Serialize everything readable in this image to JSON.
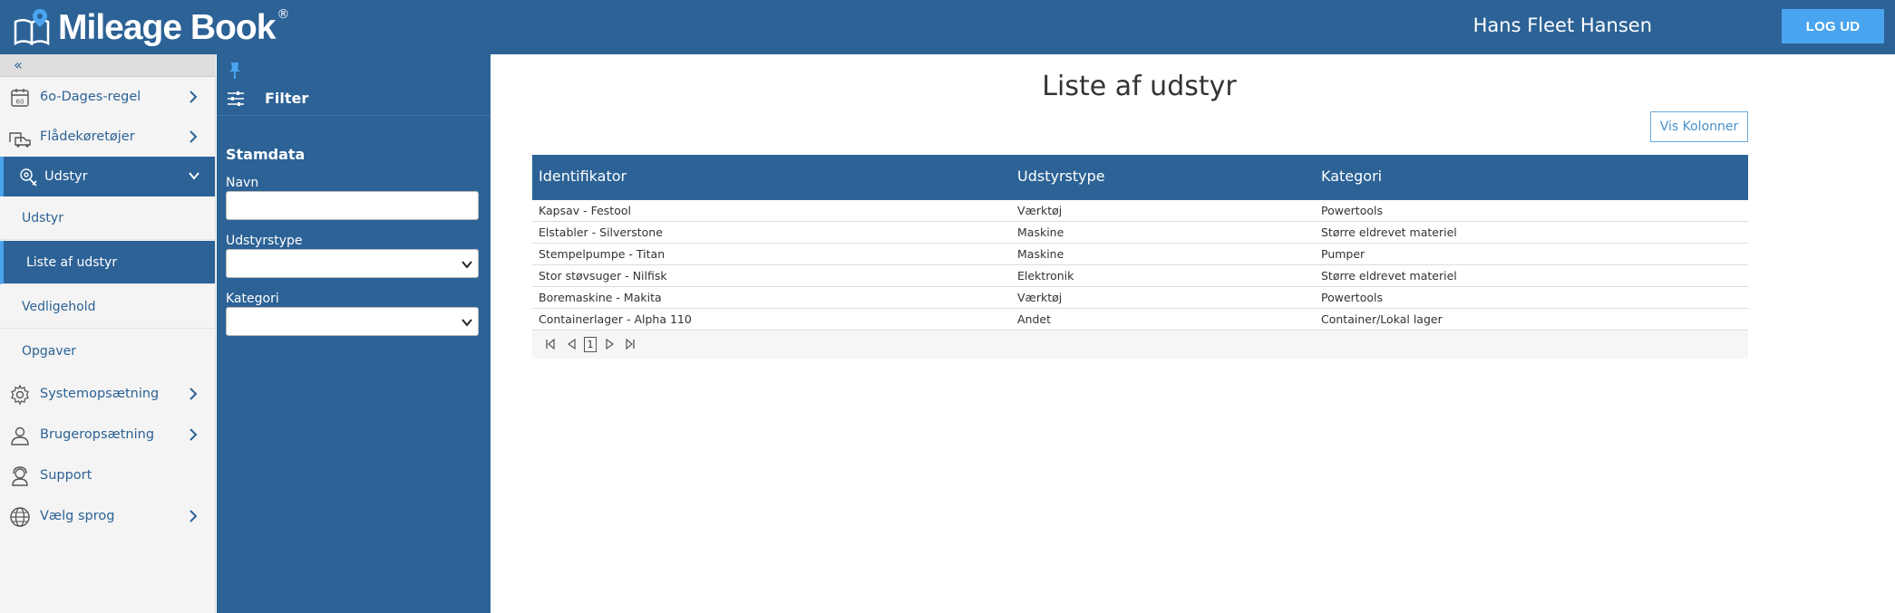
{
  "header": {
    "app_name": "Mileage Book",
    "reg_mark": "®",
    "user_name": "Hans Fleet Hansen",
    "logout_label": "LOG UD",
    "bg_color": "#2c6296",
    "accent_color": "#4aa4ef"
  },
  "nav": {
    "collapse_glyph": "«",
    "items": [
      {
        "label": "6o-Dages-regel",
        "icon": "calendar-60-icon",
        "has_chevron": true
      },
      {
        "label": "Flådekøretøjer",
        "icon": "vehicles-icon",
        "has_chevron": true
      },
      {
        "label": "Udstyr",
        "icon": "tools-icon",
        "has_chevron": true,
        "expanded": true,
        "active": true
      },
      {
        "label": "Systemopsætning",
        "icon": "gear-icon",
        "has_chevron": true
      },
      {
        "label": "Brugeropsætning",
        "icon": "user-icon",
        "has_chevron": true
      },
      {
        "label": "Support",
        "icon": "support-icon",
        "has_chevron": false
      },
      {
        "label": "Vælg sprog",
        "icon": "globe-icon",
        "has_chevron": true
      }
    ],
    "sub_items": [
      {
        "label": "Udstyr",
        "active": false
      },
      {
        "label": "Liste af udstyr",
        "active": true
      },
      {
        "label": "Vedligehold",
        "active": false
      },
      {
        "label": "Opgaver",
        "active": false
      }
    ]
  },
  "filter": {
    "title": "Filter",
    "section": "Stamdata",
    "fields": {
      "name_label": "Navn",
      "name_value": "",
      "type_label": "Udstyrstype",
      "type_value": "",
      "category_label": "Kategori",
      "category_value": ""
    }
  },
  "main": {
    "title": "Liste af udstyr",
    "show_columns_label": "Vis Kolonner",
    "columns": [
      "Identifikator",
      "Udstyrstype",
      "Kategori"
    ],
    "rows": [
      [
        "Kapsav - Festool",
        "Værktøj",
        "Powertools"
      ],
      [
        "Elstabler - Silverstone",
        "Maskine",
        "Større eldrevet materiel"
      ],
      [
        "Stempelpumpe - Titan",
        "Maskine",
        "Pumper"
      ],
      [
        "Stor støvsuger - Nilfisk",
        "Elektronik",
        "Større eldrevet materiel"
      ],
      [
        "Boremaskine - Makita",
        "Værktøj",
        "Powertools"
      ],
      [
        "Containerlager - Alpha 110",
        "Andet",
        "Container/Lokal lager"
      ]
    ],
    "pager": {
      "current_page": "1",
      "first_glyph": "|◁",
      "prev_glyph": "◁",
      "next_glyph": "▷",
      "last_glyph": "▷|"
    }
  }
}
